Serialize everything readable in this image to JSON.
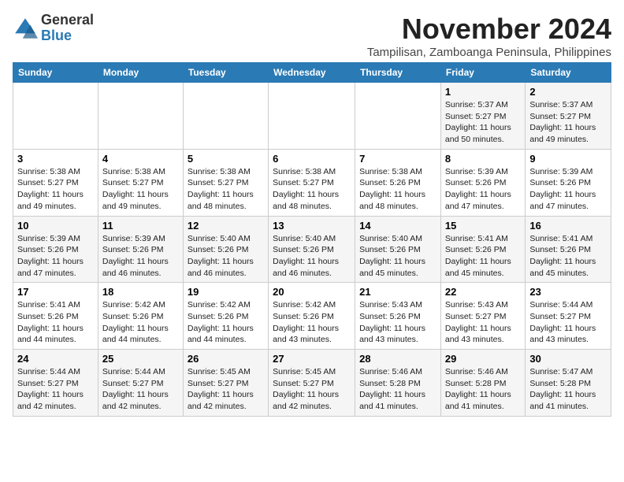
{
  "logo": {
    "general": "General",
    "blue": "Blue"
  },
  "title": "November 2024",
  "location": "Tampilisan, Zamboanga Peninsula, Philippines",
  "days_header": [
    "Sunday",
    "Monday",
    "Tuesday",
    "Wednesday",
    "Thursday",
    "Friday",
    "Saturday"
  ],
  "weeks": [
    [
      {
        "day": "",
        "info": ""
      },
      {
        "day": "",
        "info": ""
      },
      {
        "day": "",
        "info": ""
      },
      {
        "day": "",
        "info": ""
      },
      {
        "day": "",
        "info": ""
      },
      {
        "day": "1",
        "info": "Sunrise: 5:37 AM\nSunset: 5:27 PM\nDaylight: 11 hours\nand 50 minutes."
      },
      {
        "day": "2",
        "info": "Sunrise: 5:37 AM\nSunset: 5:27 PM\nDaylight: 11 hours\nand 49 minutes."
      }
    ],
    [
      {
        "day": "3",
        "info": "Sunrise: 5:38 AM\nSunset: 5:27 PM\nDaylight: 11 hours\nand 49 minutes."
      },
      {
        "day": "4",
        "info": "Sunrise: 5:38 AM\nSunset: 5:27 PM\nDaylight: 11 hours\nand 49 minutes."
      },
      {
        "day": "5",
        "info": "Sunrise: 5:38 AM\nSunset: 5:27 PM\nDaylight: 11 hours\nand 48 minutes."
      },
      {
        "day": "6",
        "info": "Sunrise: 5:38 AM\nSunset: 5:27 PM\nDaylight: 11 hours\nand 48 minutes."
      },
      {
        "day": "7",
        "info": "Sunrise: 5:38 AM\nSunset: 5:26 PM\nDaylight: 11 hours\nand 48 minutes."
      },
      {
        "day": "8",
        "info": "Sunrise: 5:39 AM\nSunset: 5:26 PM\nDaylight: 11 hours\nand 47 minutes."
      },
      {
        "day": "9",
        "info": "Sunrise: 5:39 AM\nSunset: 5:26 PM\nDaylight: 11 hours\nand 47 minutes."
      }
    ],
    [
      {
        "day": "10",
        "info": "Sunrise: 5:39 AM\nSunset: 5:26 PM\nDaylight: 11 hours\nand 47 minutes."
      },
      {
        "day": "11",
        "info": "Sunrise: 5:39 AM\nSunset: 5:26 PM\nDaylight: 11 hours\nand 46 minutes."
      },
      {
        "day": "12",
        "info": "Sunrise: 5:40 AM\nSunset: 5:26 PM\nDaylight: 11 hours\nand 46 minutes."
      },
      {
        "day": "13",
        "info": "Sunrise: 5:40 AM\nSunset: 5:26 PM\nDaylight: 11 hours\nand 46 minutes."
      },
      {
        "day": "14",
        "info": "Sunrise: 5:40 AM\nSunset: 5:26 PM\nDaylight: 11 hours\nand 45 minutes."
      },
      {
        "day": "15",
        "info": "Sunrise: 5:41 AM\nSunset: 5:26 PM\nDaylight: 11 hours\nand 45 minutes."
      },
      {
        "day": "16",
        "info": "Sunrise: 5:41 AM\nSunset: 5:26 PM\nDaylight: 11 hours\nand 45 minutes."
      }
    ],
    [
      {
        "day": "17",
        "info": "Sunrise: 5:41 AM\nSunset: 5:26 PM\nDaylight: 11 hours\nand 44 minutes."
      },
      {
        "day": "18",
        "info": "Sunrise: 5:42 AM\nSunset: 5:26 PM\nDaylight: 11 hours\nand 44 minutes."
      },
      {
        "day": "19",
        "info": "Sunrise: 5:42 AM\nSunset: 5:26 PM\nDaylight: 11 hours\nand 44 minutes."
      },
      {
        "day": "20",
        "info": "Sunrise: 5:42 AM\nSunset: 5:26 PM\nDaylight: 11 hours\nand 43 minutes."
      },
      {
        "day": "21",
        "info": "Sunrise: 5:43 AM\nSunset: 5:26 PM\nDaylight: 11 hours\nand 43 minutes."
      },
      {
        "day": "22",
        "info": "Sunrise: 5:43 AM\nSunset: 5:27 PM\nDaylight: 11 hours\nand 43 minutes."
      },
      {
        "day": "23",
        "info": "Sunrise: 5:44 AM\nSunset: 5:27 PM\nDaylight: 11 hours\nand 43 minutes."
      }
    ],
    [
      {
        "day": "24",
        "info": "Sunrise: 5:44 AM\nSunset: 5:27 PM\nDaylight: 11 hours\nand 42 minutes."
      },
      {
        "day": "25",
        "info": "Sunrise: 5:44 AM\nSunset: 5:27 PM\nDaylight: 11 hours\nand 42 minutes."
      },
      {
        "day": "26",
        "info": "Sunrise: 5:45 AM\nSunset: 5:27 PM\nDaylight: 11 hours\nand 42 minutes."
      },
      {
        "day": "27",
        "info": "Sunrise: 5:45 AM\nSunset: 5:27 PM\nDaylight: 11 hours\nand 42 minutes."
      },
      {
        "day": "28",
        "info": "Sunrise: 5:46 AM\nSunset: 5:28 PM\nDaylight: 11 hours\nand 41 minutes."
      },
      {
        "day": "29",
        "info": "Sunrise: 5:46 AM\nSunset: 5:28 PM\nDaylight: 11 hours\nand 41 minutes."
      },
      {
        "day": "30",
        "info": "Sunrise: 5:47 AM\nSunset: 5:28 PM\nDaylight: 11 hours\nand 41 minutes."
      }
    ]
  ]
}
